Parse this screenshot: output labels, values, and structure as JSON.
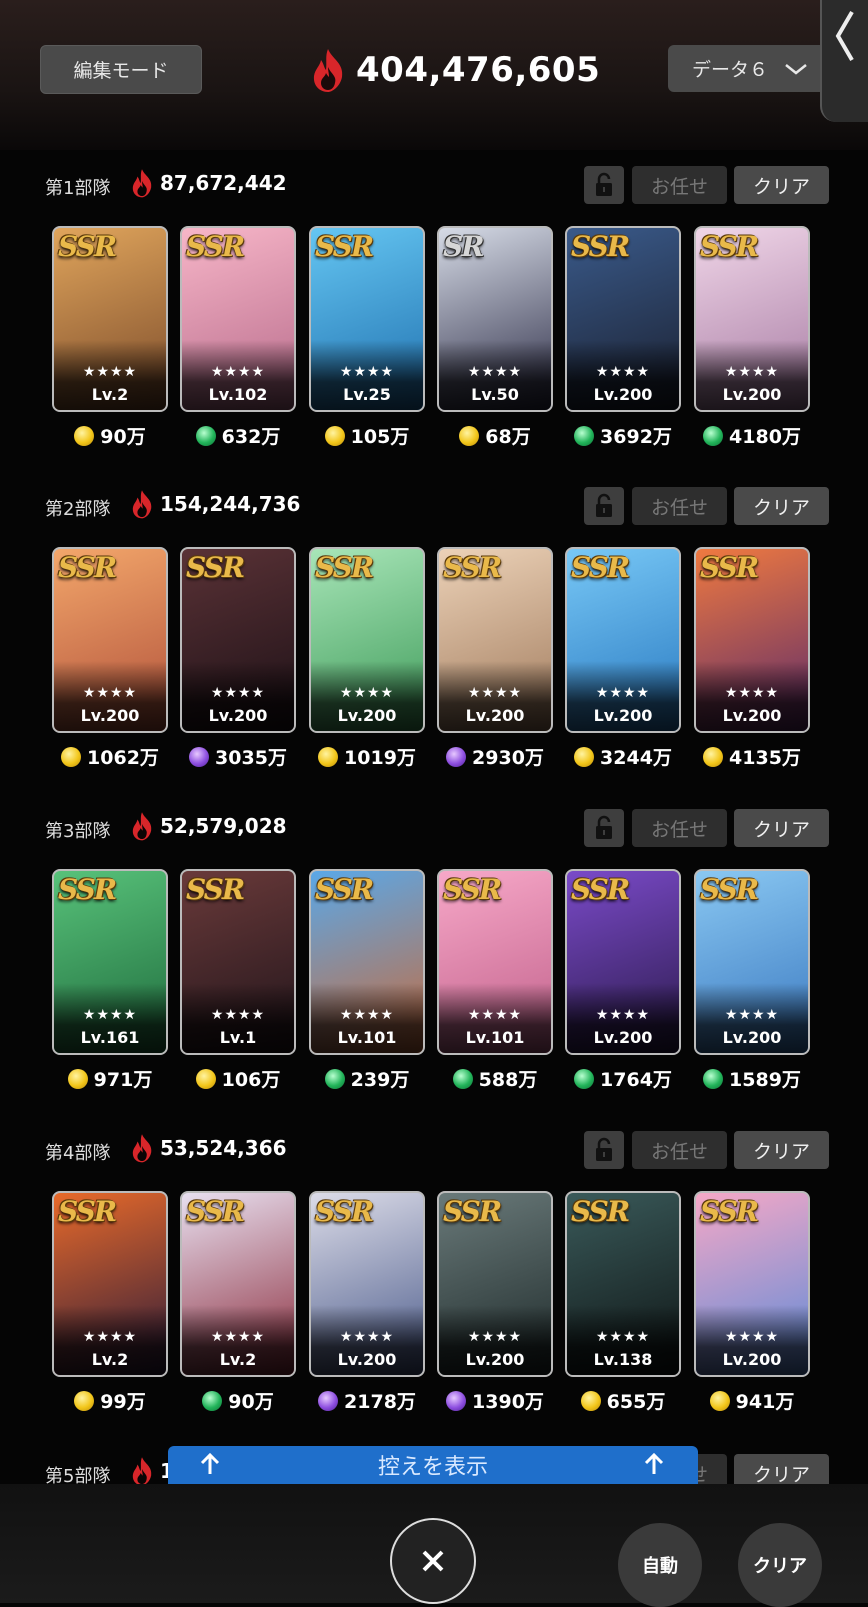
{
  "header": {
    "edit_mode_label": "編集モード",
    "total_power": "404,476,605",
    "data_select_label": "データ６"
  },
  "teams": [
    {
      "name": "第1部隊",
      "power": "87,672,442",
      "omakase_label": "お任せ",
      "clear_label": "クリア",
      "cards": [
        {
          "rarity": "SSR",
          "stars": "★★★★",
          "level": "Lv.2",
          "cost": "90万",
          "cost_type": "gold",
          "colors": [
            "#e0a55c",
            "#7a4a2a"
          ]
        },
        {
          "rarity": "SSR",
          "stars": "★★★★",
          "level": "Lv.102",
          "cost": "632万",
          "cost_type": "green",
          "colors": [
            "#f7b6c8",
            "#b66a8a"
          ]
        },
        {
          "rarity": "SSR",
          "stars": "★★★★",
          "level": "Lv.25",
          "cost": "105万",
          "cost_type": "gold",
          "colors": [
            "#65c6f2",
            "#1f6fae"
          ]
        },
        {
          "rarity": "SR",
          "stars": "★★★★",
          "level": "Lv.50",
          "cost": "68万",
          "cost_type": "gold",
          "colors": [
            "#d6dbe6",
            "#2b2b45"
          ]
        },
        {
          "rarity": "SSR",
          "stars": "★★★★",
          "level": "Lv.200",
          "cost": "3692万",
          "cost_type": "green",
          "colors": [
            "#3a5a8a",
            "#1a1f2e"
          ]
        },
        {
          "rarity": "SSR",
          "stars": "★★★★",
          "level": "Lv.200",
          "cost": "4180万",
          "cost_type": "green",
          "colors": [
            "#f0d6e8",
            "#a67aa2"
          ]
        }
      ]
    },
    {
      "name": "第2部隊",
      "power": "154,244,736",
      "omakase_label": "お任せ",
      "clear_label": "クリア",
      "cards": [
        {
          "rarity": "SSR",
          "stars": "★★★★",
          "level": "Lv.200",
          "cost": "1062万",
          "cost_type": "gold",
          "colors": [
            "#f3a76b",
            "#b0503a"
          ]
        },
        {
          "rarity": "SSR",
          "stars": "★★★★",
          "level": "Lv.200",
          "cost": "3035万",
          "cost_type": "purple",
          "colors": [
            "#5a3236",
            "#1c1016"
          ]
        },
        {
          "rarity": "SSR",
          "stars": "★★★★",
          "level": "Lv.200",
          "cost": "1019万",
          "cost_type": "gold",
          "colors": [
            "#a8e5b8",
            "#3d9a58"
          ]
        },
        {
          "rarity": "SSR",
          "stars": "★★★★",
          "level": "Lv.200",
          "cost": "2930万",
          "cost_type": "purple",
          "colors": [
            "#ecd2b8",
            "#a07a5c"
          ]
        },
        {
          "rarity": "SSR",
          "stars": "★★★★",
          "level": "Lv.200",
          "cost": "3244万",
          "cost_type": "gold",
          "colors": [
            "#78c8f6",
            "#2878c0"
          ]
        },
        {
          "rarity": "SSR",
          "stars": "★★★★",
          "level": "Lv.200",
          "cost": "4135万",
          "cost_type": "gold",
          "colors": [
            "#f07a40",
            "#5a2a6a"
          ]
        }
      ]
    },
    {
      "name": "第3部隊",
      "power": "52,579,028",
      "omakase_label": "お任せ",
      "clear_label": "クリア",
      "cards": [
        {
          "rarity": "SSR",
          "stars": "★★★★",
          "level": "Lv.161",
          "cost": "971万",
          "cost_type": "gold",
          "colors": [
            "#58c27a",
            "#1e6a3c"
          ]
        },
        {
          "rarity": "SSR",
          "stars": "★★★★",
          "level": "Lv.1",
          "cost": "106万",
          "cost_type": "gold",
          "colors": [
            "#6a3a3a",
            "#20141a"
          ]
        },
        {
          "rarity": "SSR",
          "stars": "★★★★",
          "level": "Lv.101",
          "cost": "239万",
          "cost_type": "green",
          "colors": [
            "#5aa8e8",
            "#c86a3a"
          ]
        },
        {
          "rarity": "SSR",
          "stars": "★★★★",
          "level": "Lv.101",
          "cost": "588万",
          "cost_type": "green",
          "colors": [
            "#f7a8c8",
            "#c0608a"
          ]
        },
        {
          "rarity": "SSR",
          "stars": "★★★★",
          "level": "Lv.200",
          "cost": "1764万",
          "cost_type": "green",
          "colors": [
            "#7a4ac8",
            "#2a1a4a"
          ]
        },
        {
          "rarity": "SSR",
          "stars": "★★★★",
          "level": "Lv.200",
          "cost": "1589万",
          "cost_type": "green",
          "colors": [
            "#8ac8f2",
            "#3a78c0"
          ]
        }
      ]
    },
    {
      "name": "第4部隊",
      "power": "53,524,366",
      "omakase_label": "お任せ",
      "clear_label": "クリア",
      "cards": [
        {
          "rarity": "SSR",
          "stars": "★★★★",
          "level": "Lv.2",
          "cost": "99万",
          "cost_type": "gold",
          "colors": [
            "#e86a2a",
            "#2a1a3a"
          ]
        },
        {
          "rarity": "SSR",
          "stars": "★★★★",
          "level": "Lv.2",
          "cost": "90万",
          "cost_type": "green",
          "colors": [
            "#e8e0f0",
            "#8a2a3a"
          ]
        },
        {
          "rarity": "SSR",
          "stars": "★★★★",
          "level": "Lv.200",
          "cost": "2178万",
          "cost_type": "purple",
          "colors": [
            "#dcdce8",
            "#4a5a8a"
          ]
        },
        {
          "rarity": "SSR",
          "stars": "★★★★",
          "level": "Lv.200",
          "cost": "1390万",
          "cost_type": "purple",
          "colors": [
            "#6a7a7a",
            "#1e2a2a"
          ]
        },
        {
          "rarity": "SSR",
          "stars": "★★★★",
          "level": "Lv.138",
          "cost": "655万",
          "cost_type": "gold",
          "colors": [
            "#3a5a5a",
            "#0e1414"
          ]
        },
        {
          "rarity": "SSR",
          "stars": "★★★★",
          "level": "Lv.200",
          "cost": "941万",
          "cost_type": "gold",
          "colors": [
            "#f6a8c6",
            "#5a8ad8"
          ]
        }
      ]
    },
    {
      "name": "第5部隊",
      "power": "1",
      "omakase_label": "お任せ",
      "clear_label": "クリア",
      "cards": []
    }
  ],
  "reserve_label": "控えを表示",
  "bottom": {
    "auto_label": "自動",
    "clear_label": "クリア"
  },
  "icons": {
    "flame": "flame-icon",
    "lock": "unlock-icon",
    "close": "close-icon",
    "chevron": "chevron-down-icon",
    "side": "chevron-left-icon",
    "arrow": "arrow-up-icon"
  },
  "colors": {
    "accent_flame": "#e0302a",
    "reserve_bar": "#1f6fcb",
    "rarity_gold": "#e9b94a"
  }
}
